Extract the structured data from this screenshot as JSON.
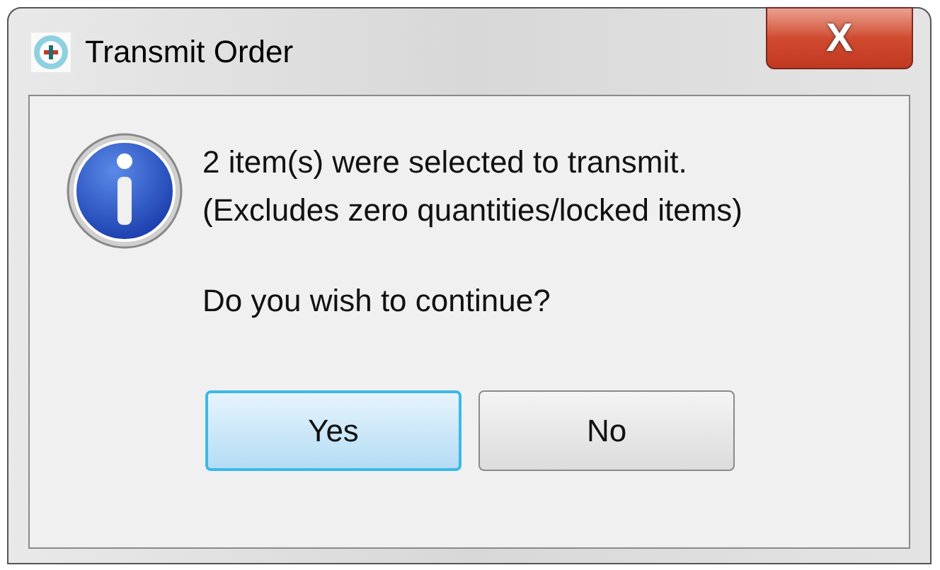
{
  "window": {
    "title": "Transmit Order",
    "close_label": "X"
  },
  "message": {
    "lines": [
      "2 item(s) were selected to transmit.",
      "(Excludes zero quantities/locked items)"
    ],
    "question": "Do you wish to continue?"
  },
  "buttons": [
    {
      "label": "Yes",
      "default": true
    },
    {
      "label": "No",
      "default": false
    }
  ]
}
